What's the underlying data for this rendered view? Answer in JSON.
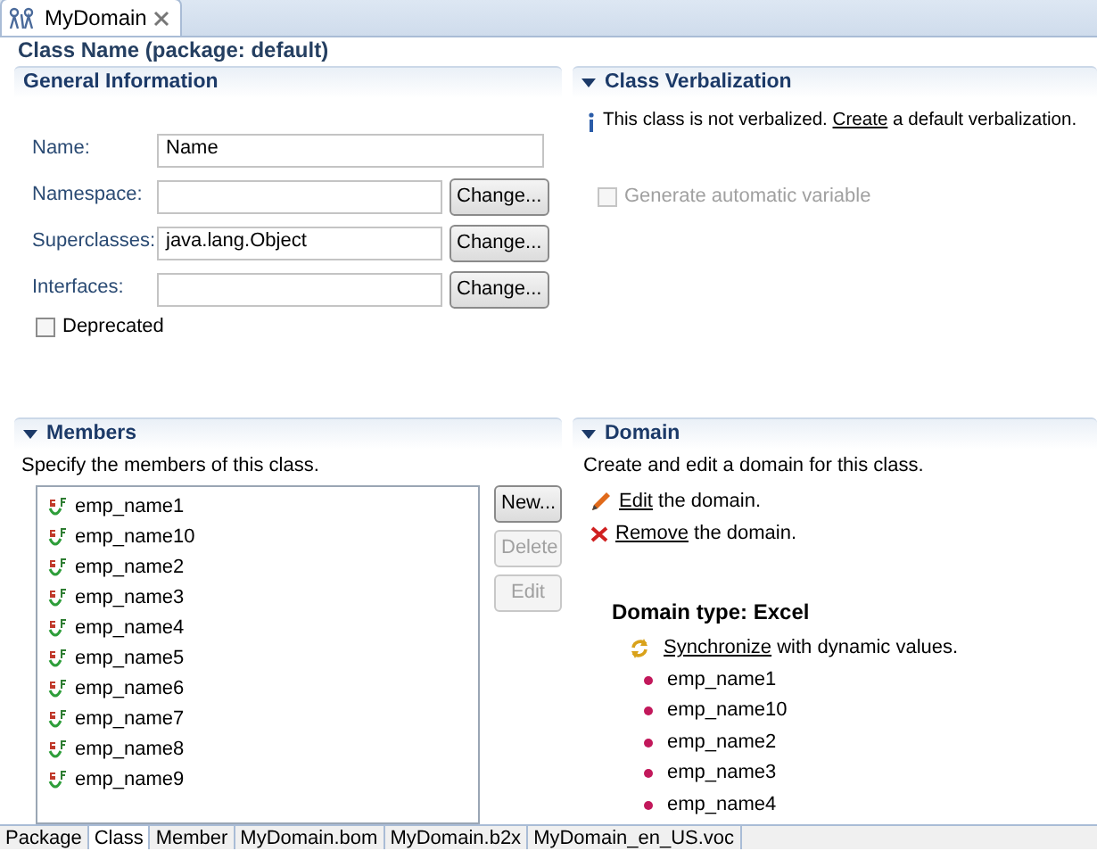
{
  "editor_tab": {
    "label": "MyDomain",
    "selected": true
  },
  "page_title": "Class Name (package: default)",
  "general_information": {
    "title": "General Information",
    "fields": [
      {
        "label": "Name:",
        "value": "Name"
      },
      {
        "label": "Namespace:",
        "button": "Change..."
      },
      {
        "label": "Superclasses:",
        "value": "java.lang.Object",
        "button": "Change..."
      },
      {
        "label": "Interfaces:",
        "button": "Change..."
      }
    ],
    "deprecated": {
      "label": "Deprecated",
      "checked": false
    }
  },
  "class_verbalization": {
    "title": "Class Verbalization",
    "expanded": true,
    "message": {
      "before": "This class is not verbalized.",
      "link": "Create",
      "after": "a default verbalization."
    },
    "option": {
      "label": "Generate automatic variable",
      "checked": false,
      "disabled": true
    }
  },
  "members": {
    "title": "Members",
    "expanded": true,
    "description": "Specify the members of this class.",
    "items": [
      "emp_name1",
      "emp_name10",
      "emp_name2",
      "emp_name3",
      "emp_name4",
      "emp_name5",
      "emp_name6",
      "emp_name7",
      "emp_name8",
      "emp_name9"
    ],
    "buttons": [
      {
        "label": "New...",
        "disabled": false
      },
      {
        "label": "Delete",
        "disabled": true
      },
      {
        "label": "Edit",
        "disabled": true
      }
    ]
  },
  "domain": {
    "title": "Domain",
    "expanded": true,
    "description": "Create and edit a domain for this class.",
    "actions": [
      {
        "kind": "edit",
        "link": "Edit",
        "text": "the domain."
      },
      {
        "kind": "remove",
        "link": "Remove",
        "text": "the domain."
      }
    ],
    "domain_type": "Domain type: Excel",
    "synchronize": {
      "link": "Synchronize",
      "text": "with dynamic values."
    },
    "values": [
      "emp_name1",
      "emp_name10",
      "emp_name2",
      "emp_name3",
      "emp_name4"
    ]
  },
  "bottom_tabs": [
    {
      "label": "Package",
      "selected": false
    },
    {
      "label": "Class",
      "selected": true
    },
    {
      "label": "Member",
      "selected": false
    },
    {
      "label": "MyDomain.bom",
      "selected": false
    },
    {
      "label": "MyDomain.b2x",
      "selected": false
    },
    {
      "label": "MyDomain_en_US.voc",
      "selected": false
    }
  ]
}
